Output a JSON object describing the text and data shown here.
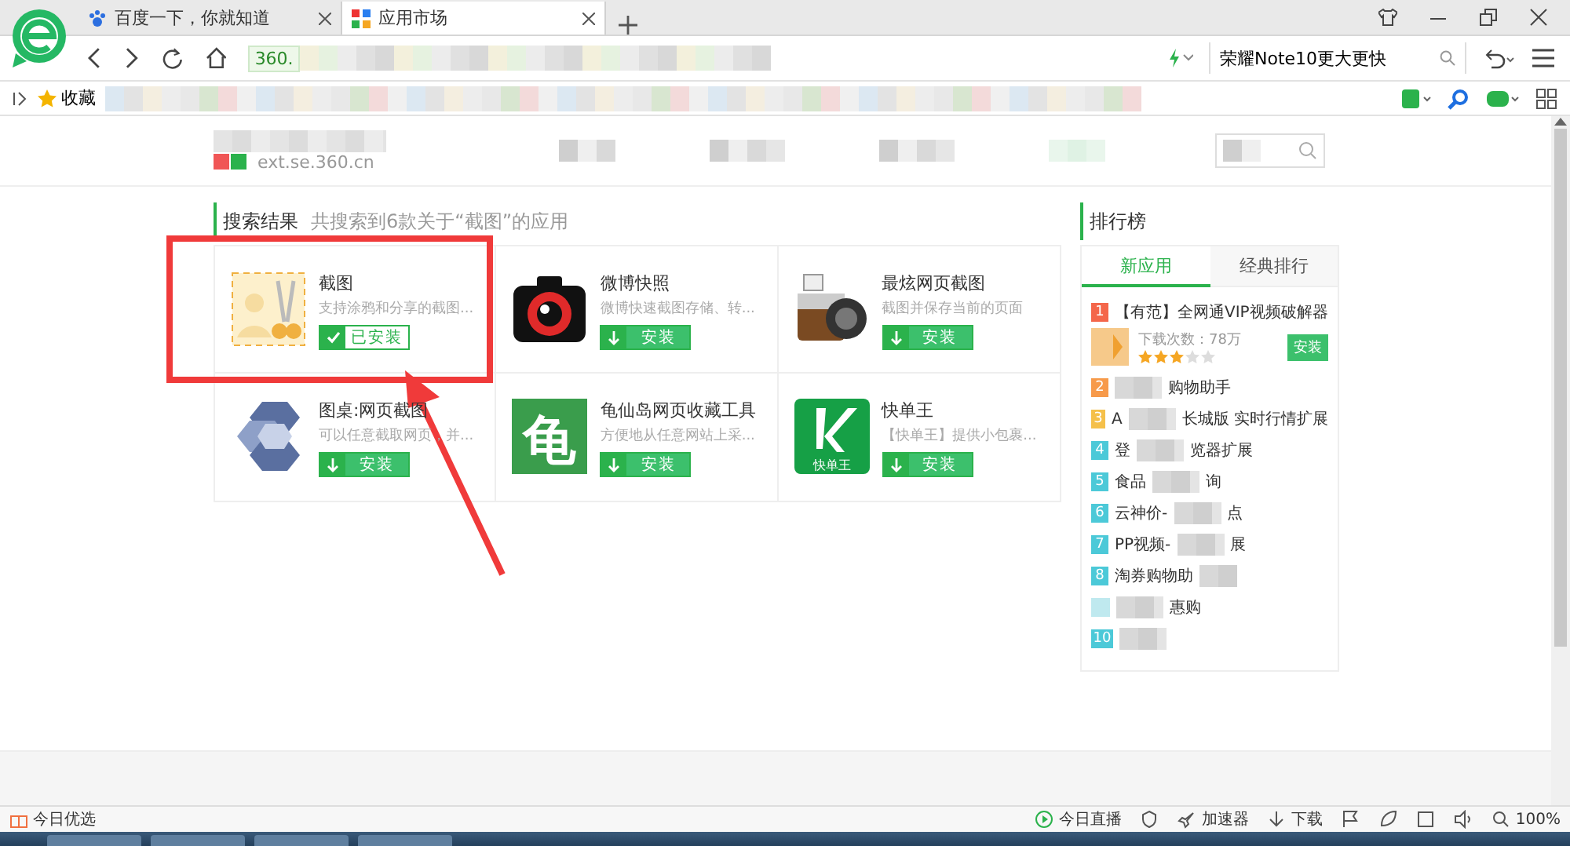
{
  "browser": {
    "tabs": [
      {
        "label": "百度一下，你就知道",
        "selected": false
      },
      {
        "label": "应用市场",
        "selected": true
      }
    ],
    "address": "360.",
    "search_value": "荣耀Note10更大更快",
    "bookmarks": [
      {
        "label": "收藏"
      }
    ]
  },
  "site": {
    "domain": "ext.se.360.cn"
  },
  "results": {
    "title": "搜索结果",
    "summary": "共搜索到6款关于“截图”的应用",
    "apps": [
      {
        "name": "截图",
        "desc": "支持涂鸦和分享的截图...",
        "installed": true,
        "button": "已安装"
      },
      {
        "name": "微博快照",
        "desc": "微博快速截图存储、转...",
        "installed": false,
        "button": "安装"
      },
      {
        "name": "最炫网页截图",
        "desc": "截图并保存当前的页面",
        "installed": false,
        "button": "安装"
      },
      {
        "name": "图桌:网页截图",
        "desc": "可以任意截取网页，并...",
        "installed": false,
        "button": "安装"
      },
      {
        "name": "龟仙岛网页收藏工具",
        "desc": "方便地从任意网站上采...",
        "glyph": "龟",
        "installed": false,
        "button": "安装"
      },
      {
        "name": "快单王",
        "desc": "【快单王】提供小包裹...",
        "glyph": "快单王",
        "installed": false,
        "button": "安装"
      }
    ]
  },
  "ranking": {
    "title": "排行榜",
    "tabs": [
      {
        "label": "新应用",
        "selected": true
      },
      {
        "label": "经典排行",
        "selected": false
      }
    ],
    "top": {
      "rank": "1",
      "name": "【有范】全网通VIP视频破解器",
      "downloads": "下载次数：78万",
      "stars": 3,
      "button": "安装"
    },
    "items": [
      {
        "rank": "2",
        "after": "购物助手"
      },
      {
        "rank": "3",
        "before": "A",
        "after": "长城版 实时行情扩展"
      },
      {
        "rank": "4",
        "before": "登",
        "after": "览器扩展"
      },
      {
        "rank": "5",
        "before": "食品",
        "after": "询"
      },
      {
        "rank": "6",
        "before": "云神价-",
        "after": "点"
      },
      {
        "rank": "7",
        "before": "PP视频-",
        "after": "展"
      },
      {
        "rank": "8",
        "before": "淘券购物助"
      },
      {
        "after": "惠购"
      },
      {
        "rank": "10"
      }
    ]
  },
  "status_bar": {
    "left": "今日优选",
    "items": [
      {
        "label": "今日直播"
      },
      {
        "label": "加速器"
      },
      {
        "label": "下载"
      },
      {
        "label": "100%"
      }
    ]
  }
}
